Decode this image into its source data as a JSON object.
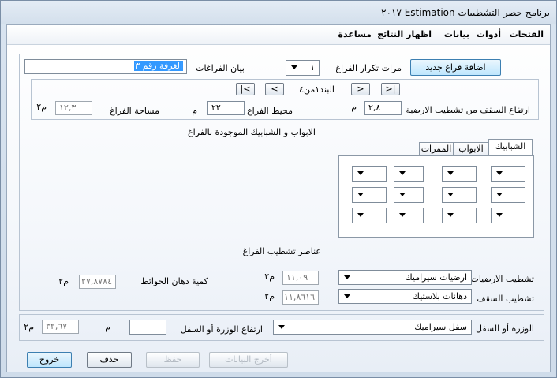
{
  "window": {
    "title": "برنامج حصر التشطيبات Estimation ٢٠١٧"
  },
  "menu": {
    "items": [
      "الفتحات",
      "أدوات",
      "بيانات",
      "اظهار النتائج",
      "مساعدة"
    ]
  },
  "top": {
    "add_space_button": "اضافة فراغ جديد",
    "repeat_label": "مرات تكرار الفراغ",
    "repeat_value": "١",
    "space_label": "بيان الفراغات",
    "space_value": "الغرفة رقم ٣"
  },
  "nav": {
    "first": "|<",
    "prev": "<",
    "record_label": "البند١من٤",
    "next": ">",
    "last": ">|"
  },
  "dims": {
    "ceiling_height_label": "ارتفاع السقف من تشطيب الارضية",
    "ceiling_height_value": "٢,٨",
    "ceiling_height_unit": "م",
    "perimeter_label": "محيط الفراغ",
    "perimeter_value": "٢٢",
    "perimeter_unit": "م",
    "area_label": "مساحة الفراغ",
    "area_value": "١٢,٣",
    "area_unit": "م٢"
  },
  "openings": {
    "title": "الابواب و الشبابيك الموجودة بالفراغ",
    "tabs": [
      "الشبابيك",
      "الابواب",
      "الممرات"
    ]
  },
  "finishes": {
    "title": "عناصر تشطيب الفراغ",
    "floor_label": "تشطيب الارضيات",
    "floor_value": "ارضيات سيراميك",
    "floor_qty": "١١,٠٩",
    "floor_unit": "م٢",
    "ceiling_label": "تشطيب السقف",
    "ceiling_value": "دهانات بلاستيك",
    "ceiling_qty": "١١,٨٦١٦",
    "ceiling_unit": "م٢",
    "wall_paint_label": "كمية دهان الحوائط",
    "wall_paint_qty": "٢٧,٨٧٨٤",
    "wall_paint_unit": "م٢"
  },
  "skirting": {
    "label": "الوزرة أو السفل",
    "value": "سفل سيراميك",
    "height_label": "ارتفاع الوزرة أو السفل",
    "height_value": "",
    "height_unit": "م",
    "qty": "٣٢,٦٧",
    "qty_unit": "م٢"
  },
  "buttons": {
    "exit": "خروج",
    "delete": "حذف",
    "save": "حفظ",
    "update": "أخرج البيانات"
  }
}
